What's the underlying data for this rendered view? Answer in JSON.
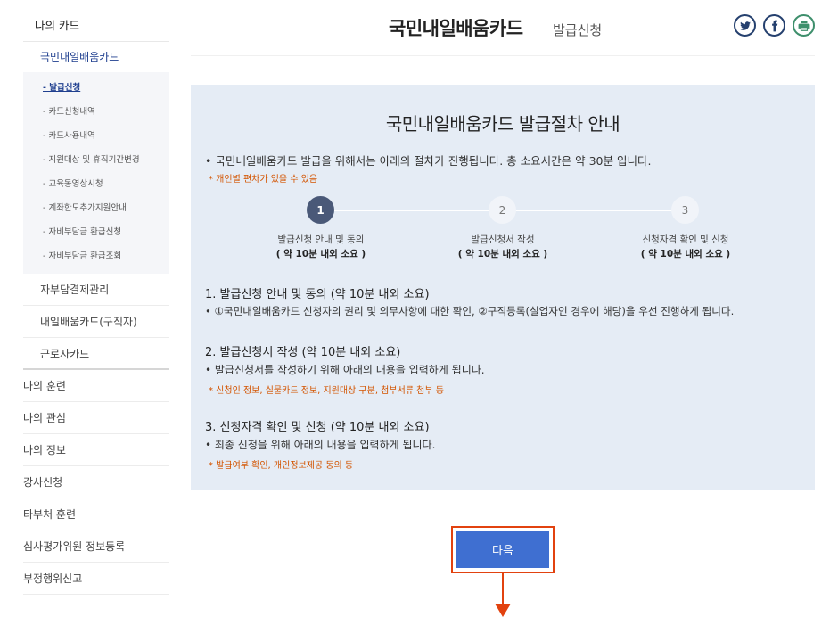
{
  "sidebar": {
    "top": "나의 카드",
    "card": "국민내일배움카드",
    "sub_items": [
      {
        "label": "- 발급신청",
        "active": true
      },
      {
        "label": "- 카드신청내역",
        "active": false
      },
      {
        "label": "- 카드사용내역",
        "active": false
      },
      {
        "label": "- 지원대상 및 휴직기간변경",
        "active": false
      },
      {
        "label": "- 교육동영상시청",
        "active": false
      },
      {
        "label": "- 계좌한도추가지원안내",
        "active": false
      },
      {
        "label": "- 자비부담금 환급신청",
        "active": false
      },
      {
        "label": "- 자비부담금 환급조회",
        "active": false
      }
    ],
    "level2": [
      "자부담결제관리",
      "내일배움카드(구직자)",
      "근로자카드"
    ],
    "level1": [
      "나의 훈련",
      "나의 관심",
      "나의 정보",
      "강사신청",
      "타부처 훈련",
      "심사평가위원 정보등록",
      "부정행위신고"
    ]
  },
  "header": {
    "title": "국민내일배움카드",
    "subtitle": "발급신청",
    "icons": [
      "twitter-icon",
      "facebook-icon",
      "print-icon"
    ]
  },
  "panel": {
    "title": "국민내일배움카드 발급절차 안내",
    "intro": "• 국민내일배움카드 발급을 위해서는 아래의 절차가 진행됩니다. 총 소요시간은 약 30분 입니다.",
    "intro_note": "* 개인별 편차가 있을 수 있음",
    "steps": [
      {
        "num": "1",
        "label": "발급신청 안내 및 동의",
        "time": "( 약 10분 내외 소요 )"
      },
      {
        "num": "2",
        "label": "발급신청서 작성",
        "time": "( 약 10분 내외 소요 )"
      },
      {
        "num": "3",
        "label": "신청자격 확인 및 신청",
        "time": "( 약 10분 내외 소요 )"
      }
    ],
    "sections": [
      {
        "title": "1. 발급신청 안내 및 동의 (약 10분 내외 소요)",
        "text": "• ①국민내일배움카드 신청자의 권리 및 의무사항에 대한 확인, ②구직등록(실업자인 경우에 해당)을 우선 진행하게 됩니다.",
        "note": ""
      },
      {
        "title": "2. 발급신청서 작성 (약 10분 내외 소요)",
        "text": "• 발급신청서를 작성하기 위해 아래의 내용을 입력하게 됩니다.",
        "note": "* 신청인 정보, 실물카드 정보, 지원대상 구분, 첨부서류 첨부 등"
      },
      {
        "title": "3. 신청자격 확인 및 신청 (약 10분 내외 소요)",
        "text": "• 최종 신청을 위해 아래의 내용을 입력하게 됩니다.",
        "note": "* 발급여부 확인, 개인정보제공 동의 등"
      }
    ]
  },
  "next_button": "다음",
  "colors": {
    "accent": "#3f6fd1",
    "highlight": "#e2420f",
    "panel_bg": "#e5ecf5",
    "note": "#d35400",
    "step_active": "#4a5978"
  }
}
